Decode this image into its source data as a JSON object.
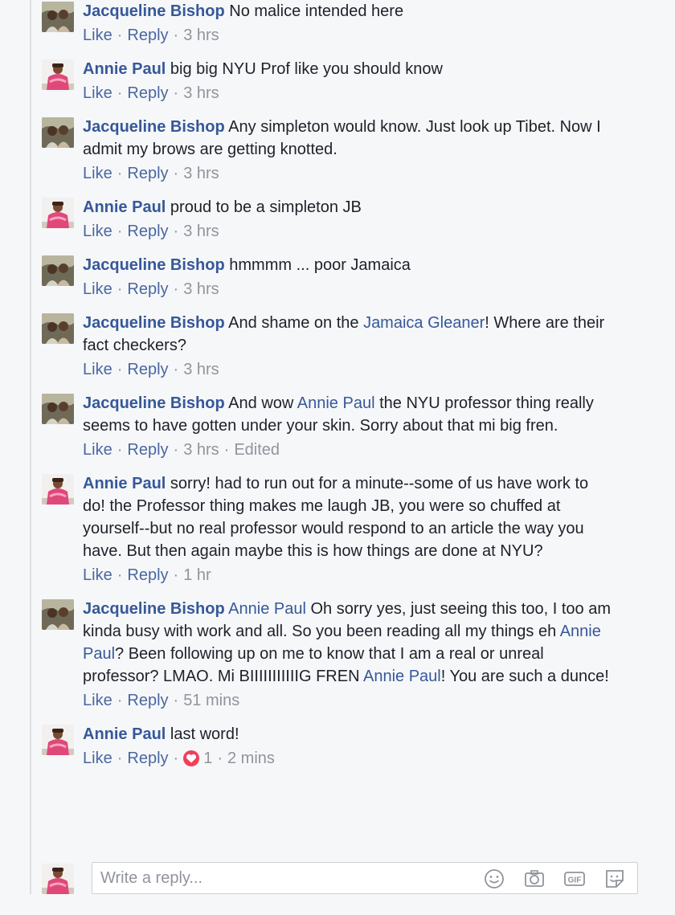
{
  "colors": {
    "author_link": "#365899",
    "action_link": "#4b67a1",
    "meta_gray": "#90949c",
    "love_react": "#f33e58"
  },
  "actions": {
    "like": "Like",
    "reply": "Reply"
  },
  "comments": [
    {
      "author": "Jacqueline Bishop",
      "avatar": "jb-avatar",
      "segments": [
        {
          "text": " No malice intended here"
        }
      ],
      "time": "3 hrs"
    },
    {
      "author": "Annie Paul",
      "avatar": "ap-avatar",
      "segments": [
        {
          "text": " big big NYU Prof like you should know"
        }
      ],
      "time": "3 hrs"
    },
    {
      "author": "Jacqueline Bishop",
      "avatar": "jb-avatar",
      "segments": [
        {
          "text": " Any simpleton would know. Just look up Tibet. Now I admit my brows are getting knotted."
        }
      ],
      "time": "3 hrs"
    },
    {
      "author": "Annie Paul",
      "avatar": "ap-avatar",
      "segments": [
        {
          "text": " proud to be a simpleton JB"
        }
      ],
      "time": "3 hrs"
    },
    {
      "author": "Jacqueline Bishop",
      "avatar": "jb-avatar",
      "segments": [
        {
          "text": " hmmmm ... poor Jamaica"
        }
      ],
      "time": "3 hrs"
    },
    {
      "author": "Jacqueline Bishop",
      "avatar": "jb-avatar",
      "segments": [
        {
          "text": " And shame on the "
        },
        {
          "text": "Jamaica Gleaner",
          "mention": true
        },
        {
          "text": "! Where are their fact checkers?"
        }
      ],
      "time": "3 hrs"
    },
    {
      "author": "Jacqueline Bishop",
      "avatar": "jb-avatar",
      "segments": [
        {
          "text": " And wow "
        },
        {
          "text": "Annie Paul",
          "mention": true
        },
        {
          "text": " the NYU professor thing really seems to have gotten under your skin. Sorry about that mi big fren."
        }
      ],
      "time": "3 hrs",
      "edited": "Edited"
    },
    {
      "author": "Annie Paul",
      "avatar": "ap-avatar",
      "segments": [
        {
          "text": " sorry! had to run out for a minute--some of us have work to do! the Professor thing makes me laugh JB, you were so chuffed at yourself--but no real professor would respond to an article the way you have. But then again maybe this is how things are done at NYU?"
        }
      ],
      "time": "1 hr"
    },
    {
      "author": "Jacqueline Bishop",
      "avatar": "jb-avatar",
      "segments": [
        {
          "text": " "
        },
        {
          "text": "Annie Paul",
          "mention": true
        },
        {
          "text": " Oh sorry yes, just seeing this too, I too am kinda busy with work and all. So you been reading all my things eh "
        },
        {
          "text": "Annie Paul",
          "mention": true
        },
        {
          "text": "? Been following up on me to know that I am a real or unreal professor? LMAO. Mi BIIIIIIIIIIIG FREN "
        },
        {
          "text": "Annie Paul",
          "mention": true
        },
        {
          "text": "! You are such a dunce!"
        }
      ],
      "time": "51 mins"
    },
    {
      "author": "Annie Paul",
      "avatar": "ap-avatar",
      "segments": [
        {
          "text": " last word!"
        }
      ],
      "time": "2 mins",
      "reactions": {
        "count": "1",
        "icon": "heart-icon"
      }
    }
  ],
  "reply": {
    "placeholder": "Write a reply...",
    "tools": [
      "emoji-icon",
      "camera-icon",
      "gif-icon",
      "sticker-icon"
    ],
    "gif_label": "GIF"
  }
}
